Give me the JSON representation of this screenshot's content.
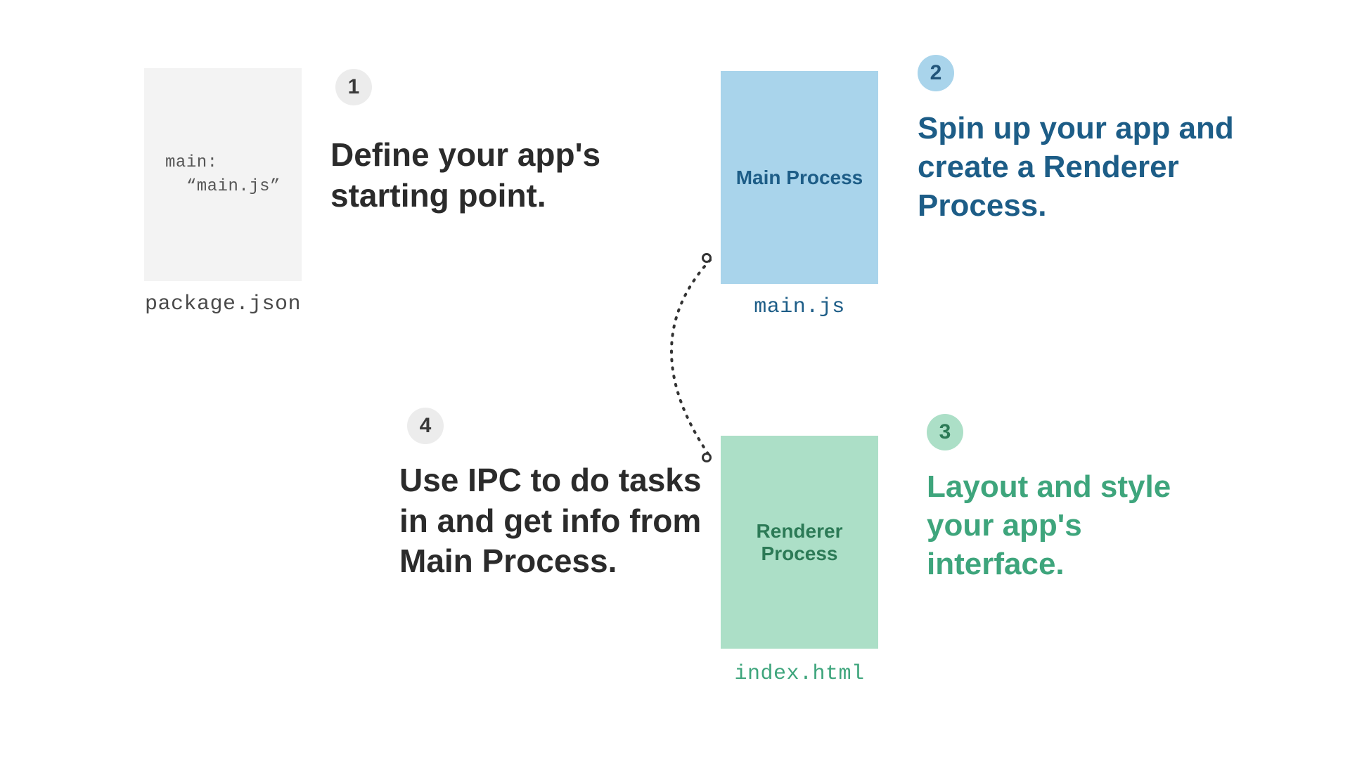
{
  "steps": {
    "s1": {
      "num": "1",
      "text": "Define your app's starting point."
    },
    "s2": {
      "num": "2",
      "text": "Spin up your app and create a Renderer Process."
    },
    "s3": {
      "num": "3",
      "text": "Layout and style your app's interface."
    },
    "s4": {
      "num": "4",
      "text": "Use IPC to do tasks in and get info from Main Process."
    }
  },
  "files": {
    "package": {
      "label": "package.json",
      "code": "main:\n  “main.js”"
    },
    "main": {
      "title": "Main Process",
      "label": "main.js"
    },
    "renderer": {
      "title": "Renderer Process",
      "label": "index.html"
    }
  },
  "colors": {
    "blue_fill": "#a9d4eb",
    "blue_text": "#1d5d87",
    "green_fill": "#acdfc7",
    "green_text": "#3ea57c",
    "gray_fill": "#f3f3f3",
    "dark_text": "#2b2b2b"
  }
}
